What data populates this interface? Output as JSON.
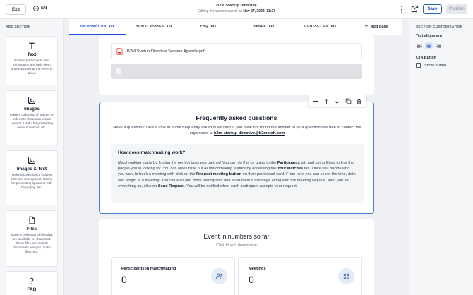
{
  "topbar": {
    "exit_label": "Exit",
    "language": "EN",
    "title": "B2M Startup Directive",
    "subtitle_prefix": "Editing the version saved on",
    "subtitle_date": "Nov 27, 2023, 11:27",
    "save_label": "Save",
    "publish_label": "Publish"
  },
  "left_panel": {
    "title": "ADD SECTION",
    "cards": [
      {
        "name": "Text",
        "icon": "text-icon",
        "description": "Provide participants with information and help them understand what the event is about."
      },
      {
        "name": "Images",
        "icon": "image-icon",
        "description": "Make a collection of images or videos to showcase visual content. Useful for presenting event sponsors, etc."
      },
      {
        "name": "Images & Text",
        "icon": "image-text-icon",
        "description": "Make a collection of images with text descriptions. Useful for presenting speakers with biography, etc."
      },
      {
        "name": "Files",
        "icon": "file-icon",
        "description": "Make a collection of files that are available for download. These files can include documents, images, audio files, etc."
      },
      {
        "name": "FAQ",
        "icon": "question-icon",
        "description": ""
      }
    ]
  },
  "tabs": {
    "items": [
      {
        "label": "INFORMATION",
        "active": true
      },
      {
        "label": "HOW IT WORKS",
        "active": false
      },
      {
        "label": "FAQ",
        "active": false
      },
      {
        "label": "VENUE",
        "active": false
      },
      {
        "label": "CONTACT US",
        "active": false
      }
    ],
    "add_page_label": "Add page"
  },
  "files_section": {
    "file_name": "B2M Startup Directive Session Agenda.pdf"
  },
  "faq_section": {
    "title": "Frequently asked questions",
    "subtitle_text": "Have a question? Take a look at some frequently asked questions! If you have not found the answer to your question feel free to contact the organisers at",
    "contact_email": "b2m-startup-directive@b2match.com",
    "question": "How does matchmaking work?",
    "answer_parts": [
      {
        "text": "Matchmaking starts by finding the perfect business partner! You can do this by going to the ",
        "bold": false
      },
      {
        "text": "Participants",
        "bold": true
      },
      {
        "text": " tab and using filters to find the people you're looking for. You can also utilise our AI matchmaking feature by accessing the ",
        "bold": false
      },
      {
        "text": "Your Matches",
        "bold": true
      },
      {
        "text": " tab. Once you decide who you want to book a meeting with click on the ",
        "bold": false
      },
      {
        "text": "Request meeting button",
        "bold": true
      },
      {
        "text": " on their participant card. From here you can select the time, date and length of a meeting. You can also add more participants and send them a message along with the meeting request. After you set everything up, click on ",
        "bold": false
      },
      {
        "text": "Send Request",
        "bold": true
      },
      {
        "text": ". You will be notified when each participant accepts your request.",
        "bold": false
      }
    ]
  },
  "stats_section": {
    "title": "Event in numbers so far",
    "subtitle": "Click to edit description",
    "stats": [
      {
        "label": "Participants in matchmaking",
        "value": "0",
        "icon": "people-icon"
      },
      {
        "label": "Meetings",
        "value": "0",
        "icon": "meetings-grid-icon"
      }
    ]
  },
  "right_panel": {
    "title": "SECTION CUSTOMIZATION",
    "text_alignment_label": "Text alignment",
    "alignment_selected": "center",
    "cta_label": "CTA Button",
    "show_button_label": "Show button",
    "show_button_checked": false
  },
  "colors": {
    "accent": "#1d4ed8",
    "selected_border": "#4a7fd8",
    "pdf_red": "#d92d20"
  }
}
